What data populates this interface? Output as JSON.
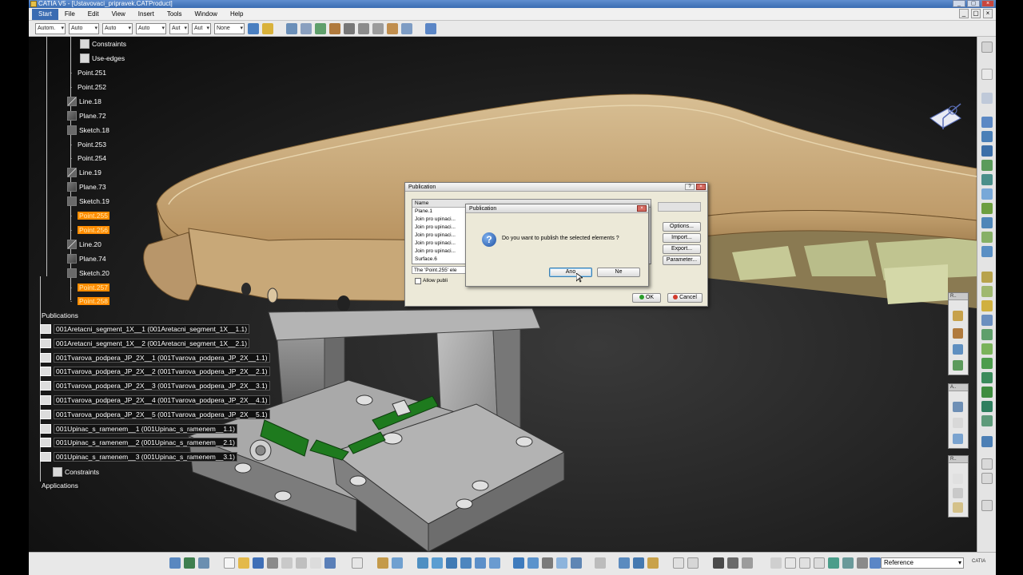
{
  "window": {
    "title": "CATIA V5 - [Ustavovaci_pripravek.CATProduct]"
  },
  "menubar": {
    "items": [
      "Start",
      "File",
      "Edit",
      "View",
      "Insert",
      "Tools",
      "Window",
      "Help"
    ]
  },
  "property_toolbar": {
    "combos": [
      "Autom.",
      "Auto",
      "Auto",
      "Auto",
      "Aut",
      "Aut",
      "None"
    ]
  },
  "tree": {
    "top_items": [
      {
        "label": "Constraints",
        "icon": "constraints-icon"
      },
      {
        "label": "Use-edges",
        "icon": "use-edges-icon"
      }
    ],
    "features": [
      {
        "label": "Point.251",
        "icon": "point-icon",
        "highlighted": false
      },
      {
        "label": "Point.252",
        "icon": "point-icon",
        "highlighted": false
      },
      {
        "label": "Line.18",
        "icon": "line-icon",
        "highlighted": false
      },
      {
        "label": "Plane.72",
        "icon": "plane-icon",
        "highlighted": false
      },
      {
        "label": "Sketch.18",
        "icon": "sketch-icon",
        "highlighted": false
      },
      {
        "label": "Point.253",
        "icon": "point-icon",
        "highlighted": false
      },
      {
        "label": "Point.254",
        "icon": "point-icon",
        "highlighted": false
      },
      {
        "label": "Line.19",
        "icon": "line-icon",
        "highlighted": false
      },
      {
        "label": "Plane.73",
        "icon": "plane-icon",
        "highlighted": false
      },
      {
        "label": "Sketch.19",
        "icon": "sketch-icon",
        "highlighted": false
      },
      {
        "label": "Point.255",
        "icon": "point-icon",
        "highlighted": true
      },
      {
        "label": "Point.256",
        "icon": "point-icon",
        "highlighted": true
      },
      {
        "label": "Line.20",
        "icon": "line-icon",
        "highlighted": false
      },
      {
        "label": "Plane.74",
        "icon": "plane-icon",
        "highlighted": false
      },
      {
        "label": "Sketch.20",
        "icon": "sketch-icon",
        "highlighted": false
      },
      {
        "label": "Point.257",
        "icon": "point-icon",
        "highlighted": true
      },
      {
        "label": "Point.258",
        "icon": "point-icon",
        "highlighted": true
      }
    ],
    "publications_label": "Publications",
    "publications": [
      "001Aretacni_segment_1X__1 (001Aretacni_segment_1X__1.1)",
      "001Aretacni_segment_1X__2 (001Aretacni_segment_1X__2.1)",
      "001Tvarova_podpera_JP_2X__1 (001Tvarova_podpera_JP_2X__1.1)",
      "001Tvarova_podpera_JP_2X__2 (001Tvarova_podpera_JP_2X__2.1)",
      "001Tvarova_podpera_JP_2X__3 (001Tvarova_podpera_JP_2X__3.1)",
      "001Tvarova_podpera_JP_2X__4 (001Tvarova_podpera_JP_2X__4.1)",
      "001Tvarova_podpera_JP_2X__5 (001Tvarova_podpera_JP_2X__5.1)",
      "001Upinac_s_ramenem__1 (001Upinac_s_ramenem__1.1)",
      "001Upinac_s_ramenem__2 (001Upinac_s_ramenem__2.1)",
      "001Upinac_s_ramenem__3 (001Upinac_s_ramenem__3.1)"
    ],
    "constraints_label": "Constraints",
    "applications_label": "Applications"
  },
  "publication_dialog": {
    "title": "Publication",
    "list_header": "Name",
    "list_rows": [
      "Plane.1",
      "Join pro upinaci...",
      "Join pro upinaci...",
      "Join pro upinaci...",
      "Join pro upinaci...",
      "Join pro upinaci...",
      "Surface.6"
    ],
    "status_text": "The 'Point.255' ele",
    "allow_label": "Allow publi",
    "side_buttons": [
      "Options...",
      "Import...",
      "Export...",
      "Parameter..."
    ],
    "ok_label": "OK",
    "cancel_label": "Cancel"
  },
  "confirm_dialog": {
    "title": "Publication",
    "message": "Do you want to publish the selected elements ?",
    "yes_label": "Ano",
    "no_label": "Ne"
  },
  "bottom_toolbar": {
    "reference_value": "Reference"
  },
  "colors": {
    "highlight": "#ff8c00",
    "part_tan": "#c9a876",
    "part_grey": "#9a9a9a",
    "clamp_green": "#1e7a1e",
    "title_blue": "#3a6cb2"
  }
}
